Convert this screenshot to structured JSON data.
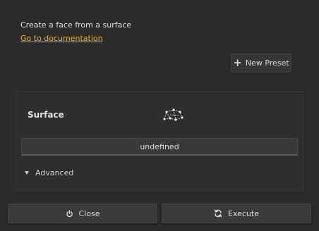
{
  "dialog": {
    "description": "Create a face from a surface",
    "doc_link": "Go to documentation"
  },
  "preset": {
    "icon": "plus-icon",
    "label": "New Preset"
  },
  "surface_panel": {
    "label": "Surface",
    "icon": "surface-mesh-icon",
    "value": "undefined",
    "advanced_label": "Advanced",
    "advanced_icon": "triangle-down-icon"
  },
  "footer": {
    "close_label": "Close",
    "close_icon": "power-icon",
    "execute_label": "Execute",
    "execute_icon": "refresh-icon"
  },
  "colors": {
    "background": "#2b2b2b",
    "link": "#f0b429",
    "text": "#dcdcdc"
  }
}
